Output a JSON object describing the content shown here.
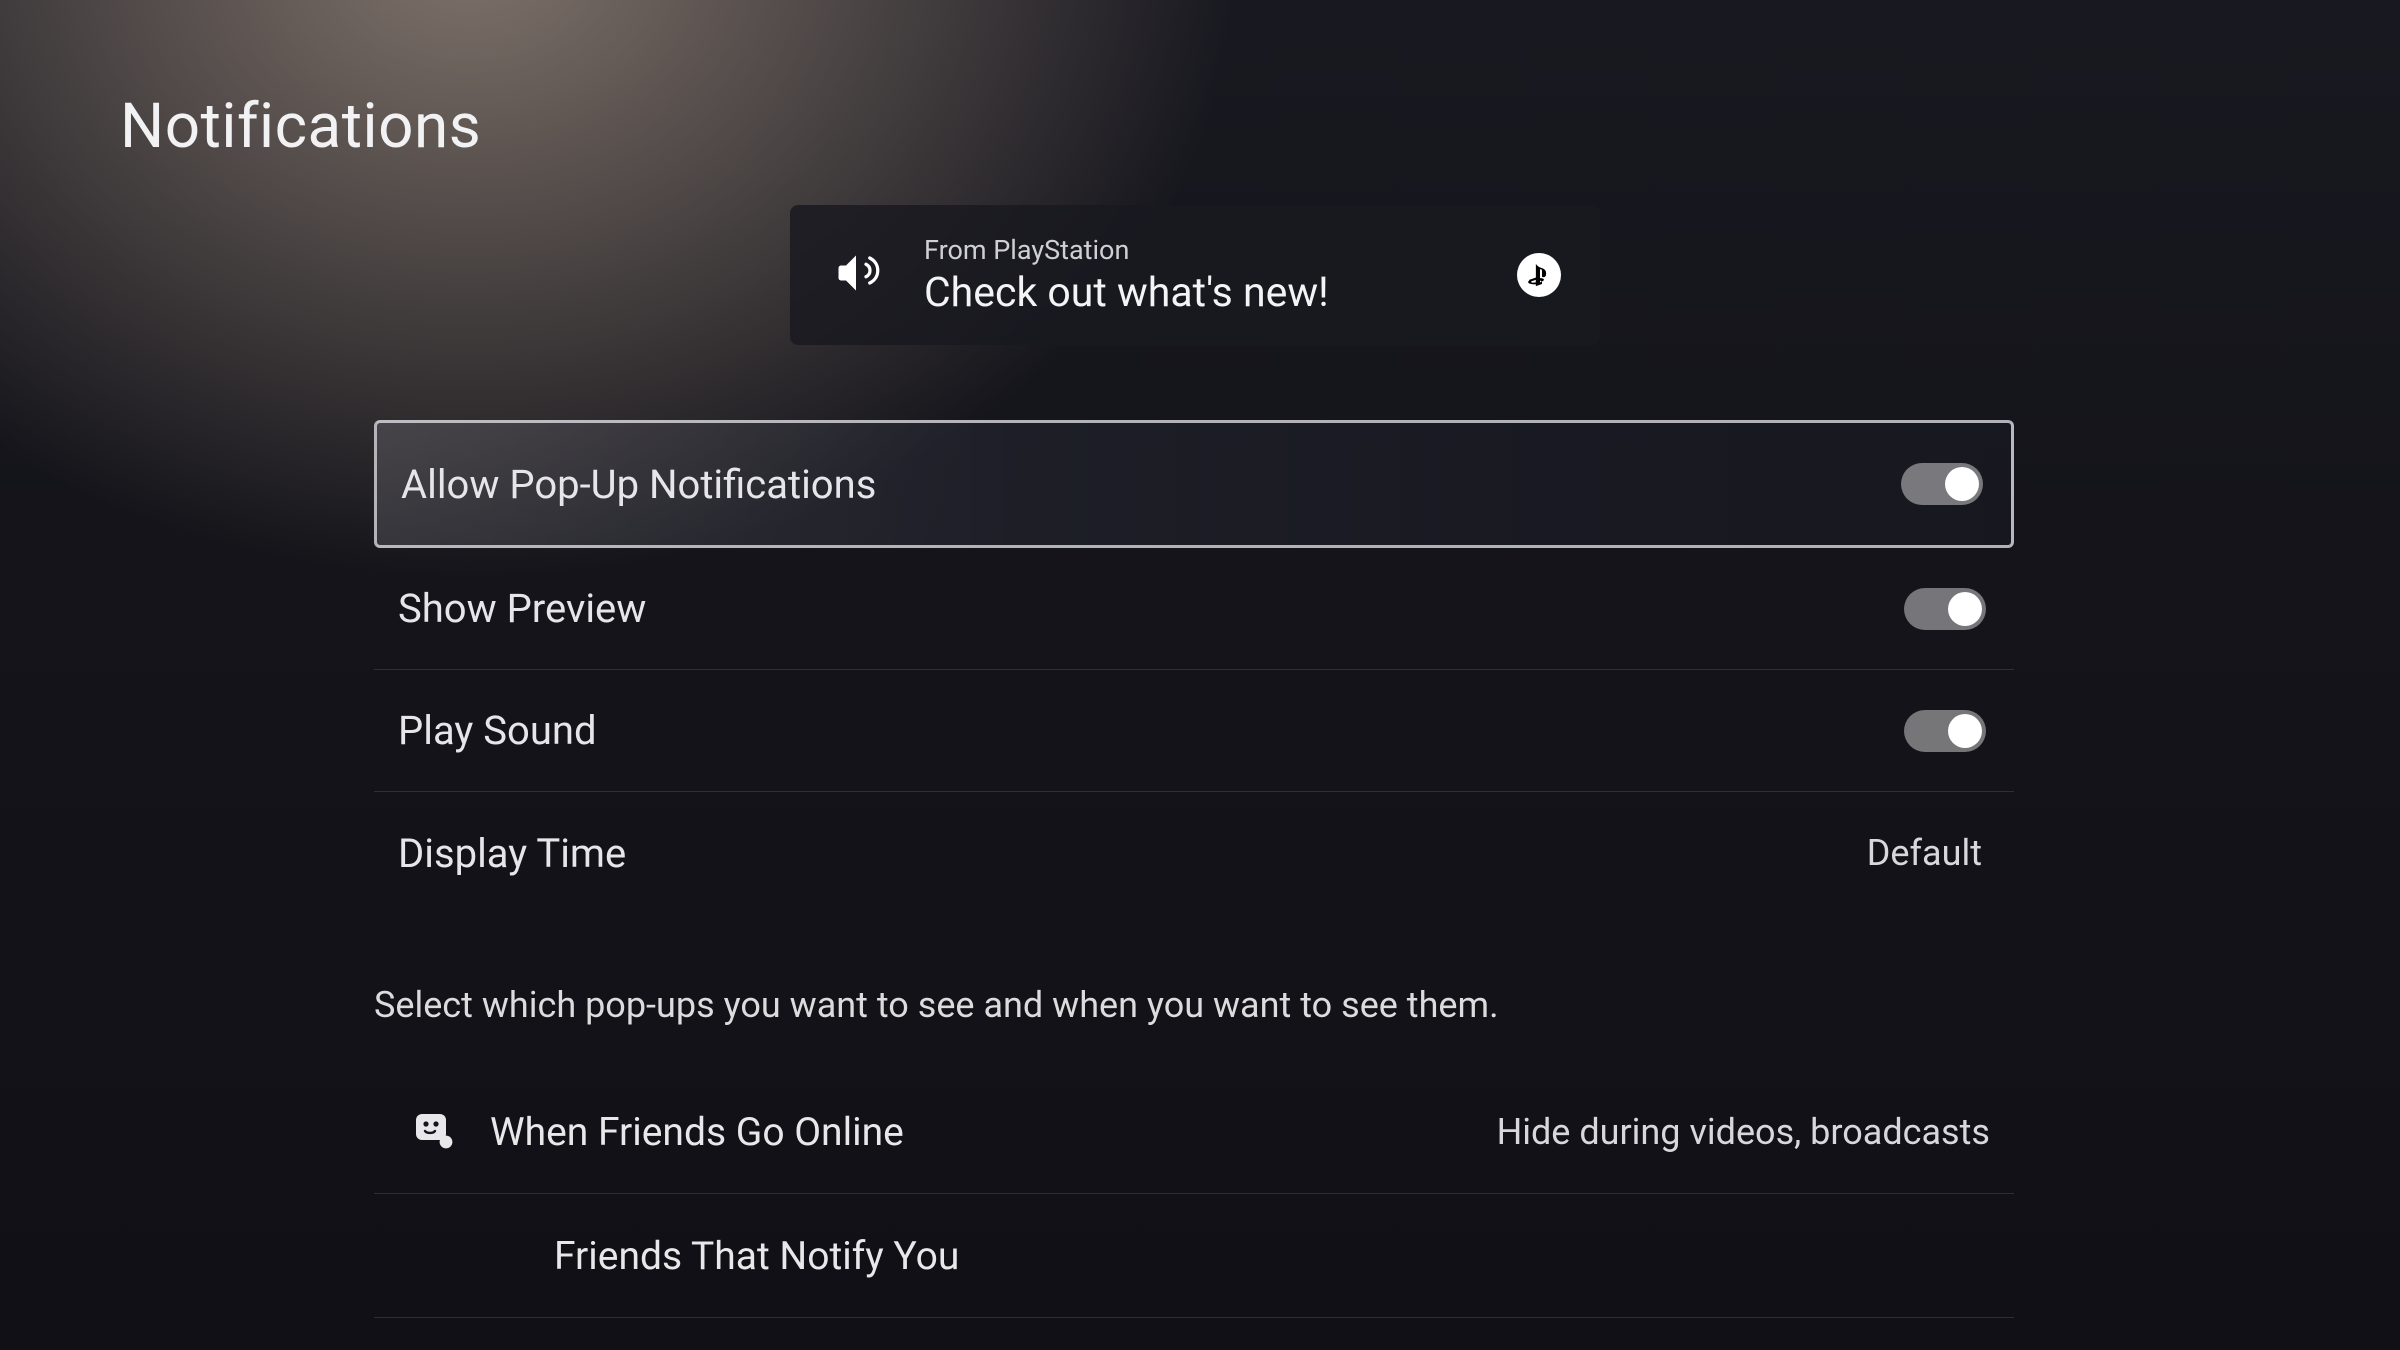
{
  "header": {
    "title": "Notifications"
  },
  "toast": {
    "from": "From PlayStation",
    "message": "Check out what's new!",
    "icon": "megaphone-icon",
    "brand": "playstation-logo"
  },
  "settings": [
    {
      "id": "allow-popup",
      "label": "Allow Pop-Up Notifications",
      "type": "toggle",
      "on": true,
      "selected": true
    },
    {
      "id": "show-preview",
      "label": "Show Preview",
      "type": "toggle",
      "on": true,
      "selected": false
    },
    {
      "id": "play-sound",
      "label": "Play Sound",
      "type": "toggle",
      "on": true,
      "selected": false
    },
    {
      "id": "display-time",
      "label": "Display Time",
      "type": "value",
      "value": "Default",
      "selected": false
    }
  ],
  "section_note": "Select which pop-ups you want to see and when you want to see them.",
  "popups": [
    {
      "id": "friends-online",
      "icon": "friend-online-icon",
      "label": "When Friends Go Online",
      "value": "Hide during videos, broadcasts"
    },
    {
      "id": "friends-notify",
      "icon": null,
      "label": "Friends That Notify You",
      "value": "",
      "indented": true
    }
  ]
}
